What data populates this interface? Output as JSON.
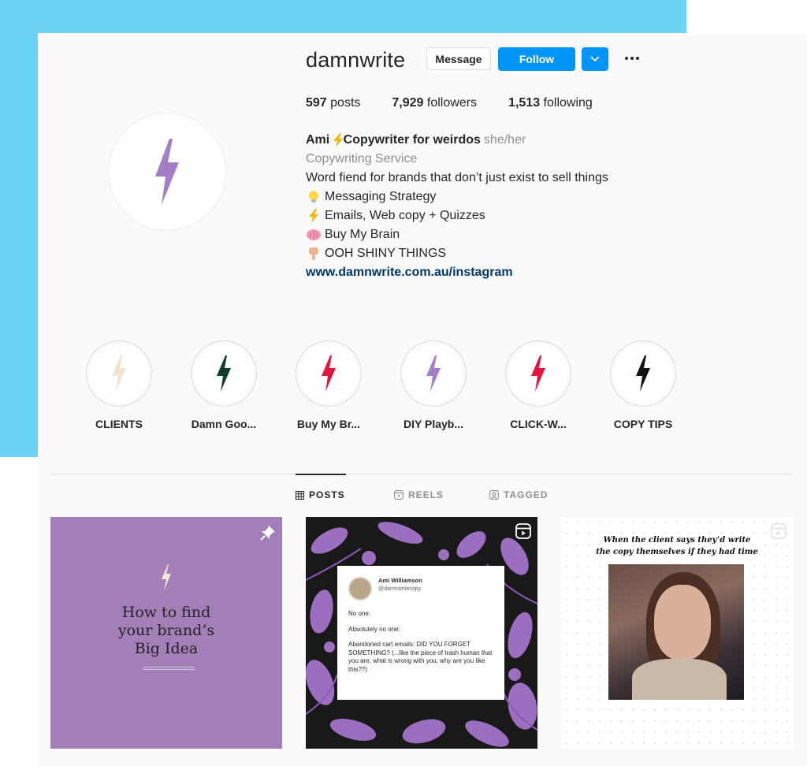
{
  "profile": {
    "username": "damnwrite",
    "message_label": "Message",
    "follow_label": "Follow",
    "stats": {
      "posts_count": "597",
      "posts_label": "posts",
      "followers_count": "7,929",
      "followers_label": "followers",
      "following_count": "1,513",
      "following_label": "following"
    },
    "bio": {
      "name_prefix": "Ami ",
      "name_suffix": "Copywriter for weirdos",
      "pronouns": "she/her",
      "category": "Copywriting Service",
      "description": "Word fiend for brands that don’t just exist to sell things",
      "line1": "Messaging Strategy",
      "line2": "Emails, Web copy + Quizzes",
      "line3": "Buy My Brain",
      "line4": "OOH SHINY THINGS",
      "link": "www.damnwrite.com.au/instagram"
    },
    "icons": {
      "avatar_bolt_color": "#a57fc6",
      "bullet1": "lightbulb-icon",
      "bullet2": "lightning-icon",
      "bullet3": "brain-icon",
      "bullet4": "pointing-down-icon"
    }
  },
  "highlights": [
    {
      "label": "CLIENTS",
      "color": "#f1e4d0"
    },
    {
      "label": "Damn Goo...",
      "color": "#133c30"
    },
    {
      "label": "Buy My Br...",
      "color": "#e3163f"
    },
    {
      "label": "DIY Playb...",
      "color": "#a57fc6"
    },
    {
      "label": "CLICK-W...",
      "color": "#e3163f"
    },
    {
      "label": "COPY TIPS",
      "color": "#111111"
    }
  ],
  "tabs": {
    "posts": "POSTS",
    "reels": "REELS",
    "tagged": "TAGGED"
  },
  "posts": {
    "post1": {
      "line1": "How to find",
      "line2": "your brand’s",
      "line3": "Big Idea"
    },
    "post2": {
      "author": "Ami Williamson",
      "handle": "@damnwritecopy",
      "p1": "No one:",
      "p2": "Absolutely no one:",
      "p3": "Abandoned cart emails: DID YOU FORGET SOMETHING?  (...like the piece of trash human that you are, what is wrong with you, why are you like this??)"
    },
    "post3": {
      "caption_line1": "When the client says they’d write",
      "caption_line2": "the copy themselves if they had time"
    }
  },
  "colors": {
    "accent_blue": "#0095f6",
    "background_blue": "#6dd3f5",
    "link_color": "#00376b",
    "post1_bg": "#a27fb6"
  }
}
